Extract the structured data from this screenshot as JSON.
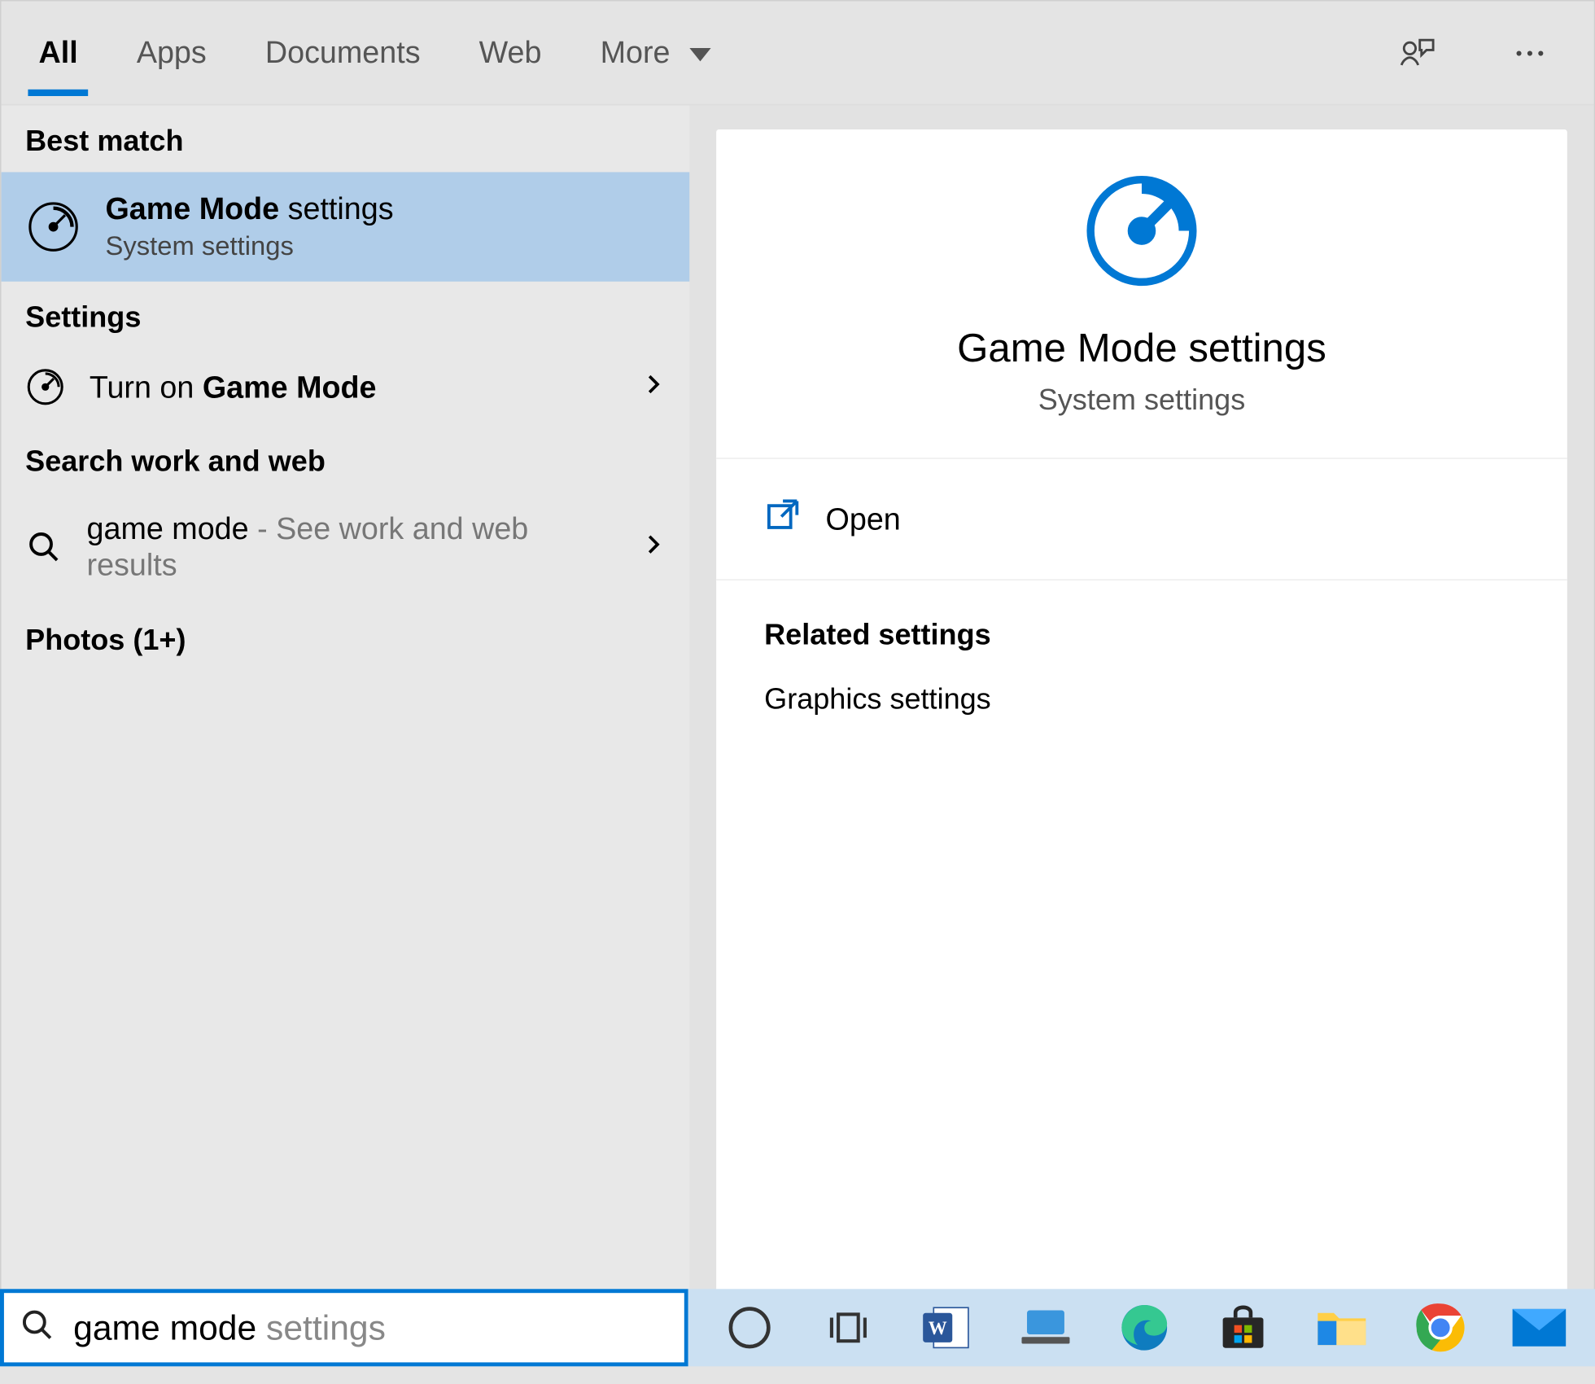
{
  "tabs": {
    "all": "All",
    "apps": "Apps",
    "documents": "Documents",
    "web": "Web",
    "more": "More"
  },
  "sections": {
    "best_match": "Best match",
    "settings": "Settings",
    "search_work_web": "Search work and web",
    "photos": "Photos (1+)"
  },
  "best_match": {
    "title_bold": "Game Mode",
    "title_rest": " settings",
    "subtitle": "System settings"
  },
  "settings_item": {
    "prefix": "Turn on ",
    "bold": "Game Mode"
  },
  "web_item": {
    "query": "game mode",
    "hint": " - See work and web results"
  },
  "preview": {
    "title": "Game Mode settings",
    "subtitle": "System settings",
    "open": "Open",
    "related_header": "Related settings",
    "graphics": "Graphics settings"
  },
  "search": {
    "typed": "game mode",
    "ghost": " settings"
  }
}
